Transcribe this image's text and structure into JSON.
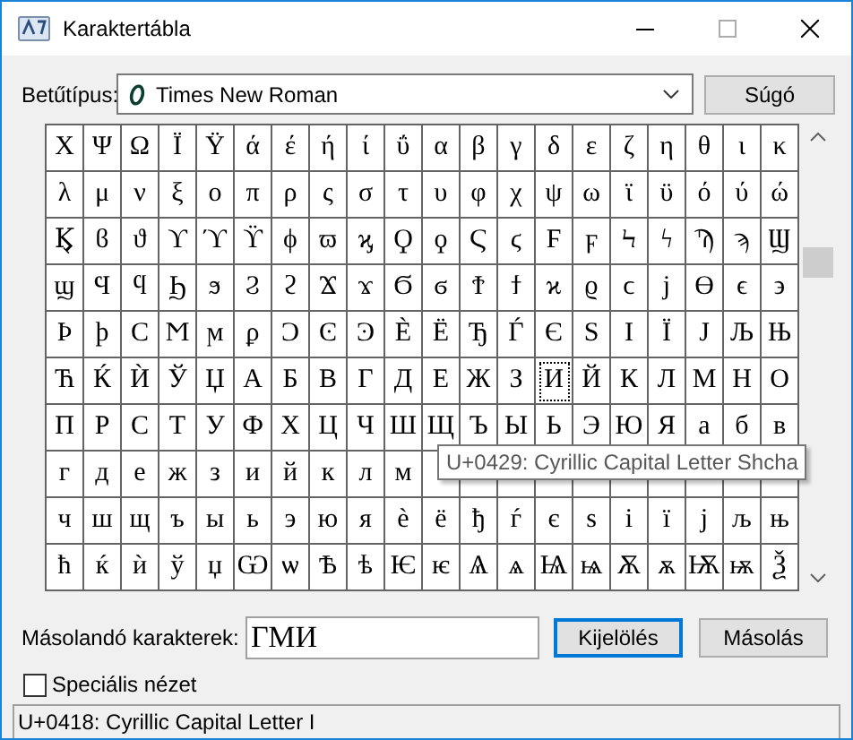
{
  "window": {
    "title": "Karaktertábla"
  },
  "font": {
    "label": "Betűtípus:",
    "value": "Times New Roman"
  },
  "help_button": {
    "label": "Súgó"
  },
  "grid": {
    "rows": [
      {
        "cells": [
          {
            "char": "Χ",
            "selected": false
          },
          {
            "char": "Ψ",
            "selected": false
          },
          {
            "char": "Ω",
            "selected": false
          },
          {
            "char": "Ϊ",
            "selected": false
          },
          {
            "char": "Ϋ",
            "selected": false
          },
          {
            "char": "ά",
            "selected": false
          },
          {
            "char": "έ",
            "selected": false
          },
          {
            "char": "ή",
            "selected": false
          },
          {
            "char": "ί",
            "selected": false
          },
          {
            "char": "ΰ",
            "selected": false
          },
          {
            "char": "α",
            "selected": false
          },
          {
            "char": "β",
            "selected": false
          },
          {
            "char": "γ",
            "selected": false
          },
          {
            "char": "δ",
            "selected": false
          },
          {
            "char": "ε",
            "selected": false
          },
          {
            "char": "ζ",
            "selected": false
          },
          {
            "char": "η",
            "selected": false
          },
          {
            "char": "θ",
            "selected": false
          },
          {
            "char": "ι",
            "selected": false
          },
          {
            "char": "κ",
            "selected": false
          }
        ]
      },
      {
        "cells": [
          {
            "char": "λ",
            "selected": false
          },
          {
            "char": "μ",
            "selected": false
          },
          {
            "char": "ν",
            "selected": false
          },
          {
            "char": "ξ",
            "selected": false
          },
          {
            "char": "ο",
            "selected": false
          },
          {
            "char": "π",
            "selected": false
          },
          {
            "char": "ρ",
            "selected": false
          },
          {
            "char": "ς",
            "selected": false
          },
          {
            "char": "σ",
            "selected": false
          },
          {
            "char": "τ",
            "selected": false
          },
          {
            "char": "υ",
            "selected": false
          },
          {
            "char": "φ",
            "selected": false
          },
          {
            "char": "χ",
            "selected": false
          },
          {
            "char": "ψ",
            "selected": false
          },
          {
            "char": "ω",
            "selected": false
          },
          {
            "char": "ϊ",
            "selected": false
          },
          {
            "char": "ϋ",
            "selected": false
          },
          {
            "char": "ό",
            "selected": false
          },
          {
            "char": "ύ",
            "selected": false
          },
          {
            "char": "ώ",
            "selected": false
          }
        ]
      },
      {
        "cells": [
          {
            "char": "Ϗ",
            "selected": false
          },
          {
            "char": "ϐ",
            "selected": false
          },
          {
            "char": "ϑ",
            "selected": false
          },
          {
            "char": "ϒ",
            "selected": false
          },
          {
            "char": "ϓ",
            "selected": false
          },
          {
            "char": "ϔ",
            "selected": false
          },
          {
            "char": "ϕ",
            "selected": false
          },
          {
            "char": "ϖ",
            "selected": false
          },
          {
            "char": "ϗ",
            "selected": false
          },
          {
            "char": "Ϙ",
            "selected": false
          },
          {
            "char": "ϙ",
            "selected": false
          },
          {
            "char": "Ϛ",
            "selected": false
          },
          {
            "char": "ϛ",
            "selected": false
          },
          {
            "char": "Ϝ",
            "selected": false
          },
          {
            "char": "ϝ",
            "selected": false
          },
          {
            "char": "Ϟ",
            "selected": false
          },
          {
            "char": "ϟ",
            "selected": false
          },
          {
            "char": "Ϡ",
            "selected": false
          },
          {
            "char": "ϡ",
            "selected": false
          },
          {
            "char": "Ϣ",
            "selected": false
          }
        ]
      },
      {
        "cells": [
          {
            "char": "ϣ",
            "selected": false
          },
          {
            "char": "Ϥ",
            "selected": false
          },
          {
            "char": "ϥ",
            "selected": false
          },
          {
            "char": "Ϧ",
            "selected": false
          },
          {
            "char": "ϧ",
            "selected": false
          },
          {
            "char": "Ϩ",
            "selected": false
          },
          {
            "char": "ϩ",
            "selected": false
          },
          {
            "char": "Ϫ",
            "selected": false
          },
          {
            "char": "ϫ",
            "selected": false
          },
          {
            "char": "Ϭ",
            "selected": false
          },
          {
            "char": "ϭ",
            "selected": false
          },
          {
            "char": "Ϯ",
            "selected": false
          },
          {
            "char": "ϯ",
            "selected": false
          },
          {
            "char": "ϰ",
            "selected": false
          },
          {
            "char": "ϱ",
            "selected": false
          },
          {
            "char": "ϲ",
            "selected": false
          },
          {
            "char": "ϳ",
            "selected": false
          },
          {
            "char": "ϴ",
            "selected": false
          },
          {
            "char": "ϵ",
            "selected": false
          },
          {
            "char": "϶",
            "selected": false
          }
        ]
      },
      {
        "cells": [
          {
            "char": "Ϸ",
            "selected": false
          },
          {
            "char": "ϸ",
            "selected": false
          },
          {
            "char": "Ϲ",
            "selected": false
          },
          {
            "char": "Ϻ",
            "selected": false
          },
          {
            "char": "ϻ",
            "selected": false
          },
          {
            "char": "ϼ",
            "selected": false
          },
          {
            "char": "Ͻ",
            "selected": false
          },
          {
            "char": "Ͼ",
            "selected": false
          },
          {
            "char": "Ͽ",
            "selected": false
          },
          {
            "char": "Ѐ",
            "selected": false
          },
          {
            "char": "Ё",
            "selected": false
          },
          {
            "char": "Ђ",
            "selected": false
          },
          {
            "char": "Ѓ",
            "selected": false
          },
          {
            "char": "Є",
            "selected": false
          },
          {
            "char": "Ѕ",
            "selected": false
          },
          {
            "char": "І",
            "selected": false
          },
          {
            "char": "Ї",
            "selected": false
          },
          {
            "char": "Ј",
            "selected": false
          },
          {
            "char": "Љ",
            "selected": false
          },
          {
            "char": "Њ",
            "selected": false
          }
        ]
      },
      {
        "cells": [
          {
            "char": "Ћ",
            "selected": false
          },
          {
            "char": "Ќ",
            "selected": false
          },
          {
            "char": "Ѝ",
            "selected": false
          },
          {
            "char": "Ў",
            "selected": false
          },
          {
            "char": "Џ",
            "selected": false
          },
          {
            "char": "А",
            "selected": false
          },
          {
            "char": "Б",
            "selected": false
          },
          {
            "char": "В",
            "selected": false
          },
          {
            "char": "Г",
            "selected": false
          },
          {
            "char": "Д",
            "selected": false
          },
          {
            "char": "Е",
            "selected": false
          },
          {
            "char": "Ж",
            "selected": false
          },
          {
            "char": "З",
            "selected": false
          },
          {
            "char": "И",
            "selected": true
          },
          {
            "char": "Й",
            "selected": false
          },
          {
            "char": "К",
            "selected": false
          },
          {
            "char": "Л",
            "selected": false
          },
          {
            "char": "М",
            "selected": false
          },
          {
            "char": "Н",
            "selected": false
          },
          {
            "char": "О",
            "selected": false
          }
        ]
      },
      {
        "cells": [
          {
            "char": "П",
            "selected": false
          },
          {
            "char": "Р",
            "selected": false
          },
          {
            "char": "С",
            "selected": false
          },
          {
            "char": "Т",
            "selected": false
          },
          {
            "char": "У",
            "selected": false
          },
          {
            "char": "Ф",
            "selected": false
          },
          {
            "char": "Х",
            "selected": false
          },
          {
            "char": "Ц",
            "selected": false
          },
          {
            "char": "Ч",
            "selected": false
          },
          {
            "char": "Ш",
            "selected": false
          },
          {
            "char": "Щ",
            "selected": false
          },
          {
            "char": "Ъ",
            "selected": false
          },
          {
            "char": "Ы",
            "selected": false
          },
          {
            "char": "Ь",
            "selected": false
          },
          {
            "char": "Э",
            "selected": false
          },
          {
            "char": "Ю",
            "selected": false
          },
          {
            "char": "Я",
            "selected": false
          },
          {
            "char": "а",
            "selected": false
          },
          {
            "char": "б",
            "selected": false
          },
          {
            "char": "в",
            "selected": false
          }
        ]
      },
      {
        "cells": [
          {
            "char": "г",
            "selected": false
          },
          {
            "char": "д",
            "selected": false
          },
          {
            "char": "е",
            "selected": false
          },
          {
            "char": "ж",
            "selected": false
          },
          {
            "char": "з",
            "selected": false
          },
          {
            "char": "и",
            "selected": false
          },
          {
            "char": "й",
            "selected": false
          },
          {
            "char": "к",
            "selected": false
          },
          {
            "char": "л",
            "selected": false
          },
          {
            "char": "м",
            "selected": false
          }
        ]
      },
      {
        "cells": [
          {
            "char": "ч",
            "selected": false
          },
          {
            "char": "ш",
            "selected": false
          },
          {
            "char": "щ",
            "selected": false
          },
          {
            "char": "ъ",
            "selected": false
          },
          {
            "char": "ы",
            "selected": false
          },
          {
            "char": "ь",
            "selected": false
          },
          {
            "char": "э",
            "selected": false
          },
          {
            "char": "ю",
            "selected": false
          },
          {
            "char": "я",
            "selected": false
          },
          {
            "char": "ѐ",
            "selected": false
          },
          {
            "char": "ё",
            "selected": false
          },
          {
            "char": "ђ",
            "selected": false
          },
          {
            "char": "ѓ",
            "selected": false
          },
          {
            "char": "є",
            "selected": false
          },
          {
            "char": "ѕ",
            "selected": false
          },
          {
            "char": "і",
            "selected": false
          },
          {
            "char": "ї",
            "selected": false
          },
          {
            "char": "ј",
            "selected": false
          },
          {
            "char": "љ",
            "selected": false
          },
          {
            "char": "њ",
            "selected": false
          }
        ]
      },
      {
        "cells": [
          {
            "char": "ћ",
            "selected": false
          },
          {
            "char": "ќ",
            "selected": false
          },
          {
            "char": "ѝ",
            "selected": false
          },
          {
            "char": "ў",
            "selected": false
          },
          {
            "char": "џ",
            "selected": false
          },
          {
            "char": "Ѡ",
            "selected": false
          },
          {
            "char": "ѡ",
            "selected": false
          },
          {
            "char": "Ѣ",
            "selected": false
          },
          {
            "char": "ѣ",
            "selected": false
          },
          {
            "char": "Ѥ",
            "selected": false
          },
          {
            "char": "ѥ",
            "selected": false
          },
          {
            "char": "Ѧ",
            "selected": false
          },
          {
            "char": "ѧ",
            "selected": false
          },
          {
            "char": "Ѩ",
            "selected": false
          },
          {
            "char": "ѩ",
            "selected": false
          },
          {
            "char": "Ѫ",
            "selected": false
          },
          {
            "char": "ѫ",
            "selected": false
          },
          {
            "char": "Ѭ",
            "selected": false
          },
          {
            "char": "ѭ",
            "selected": false
          },
          {
            "char": "Ѯ",
            "selected": false
          }
        ]
      }
    ]
  },
  "tooltip": {
    "text": "U+0429: Cyrillic Capital Letter Shcha"
  },
  "copy_field": {
    "label": "Másolandó karakterek:",
    "value": "ГМИ"
  },
  "buttons": [
    {
      "label": "Kijelölés",
      "focused": true
    },
    {
      "label": "Másolás",
      "focused": false
    }
  ],
  "advanced_view": {
    "label": "Speciális nézet",
    "checked": false
  },
  "status_bar": {
    "text": "U+0418: Cyrillic Capital Letter I"
  }
}
